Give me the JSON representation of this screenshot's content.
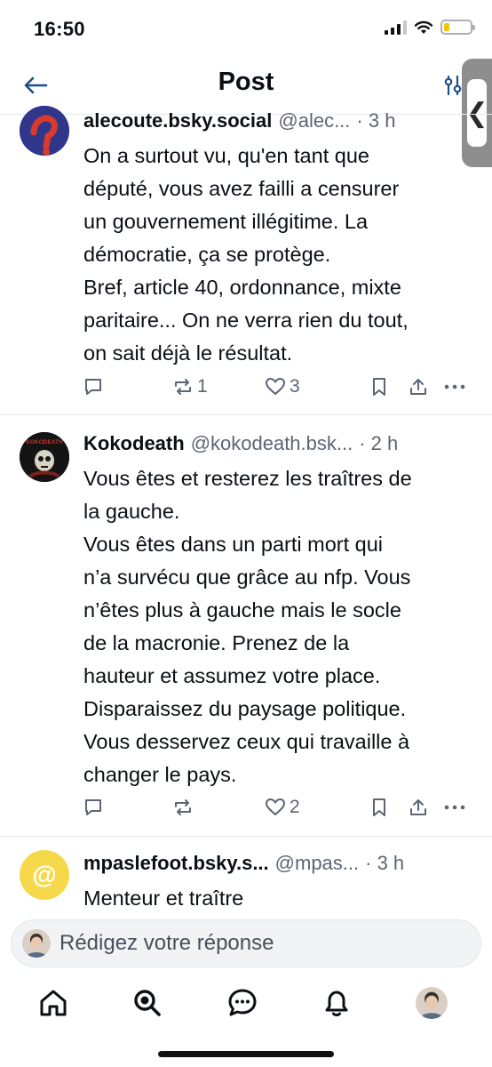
{
  "status_bar": {
    "time": "16:50"
  },
  "header": {
    "title": "Post"
  },
  "posts": [
    {
      "name": "alecoute.bsky.social",
      "handle": "@alec...",
      "time": "· 3 h",
      "lines": [
        "On a surtout vu, qu'en tant que",
        "député, vous avez failli a censurer",
        "un gouvernement illégitime. La",
        "démocratie, ça se protège.",
        "Bref, article 40, ordonnance, mixte",
        "paritaire... On ne verra rien du tout,",
        "on sait déjà le résultat."
      ],
      "reposts": "1",
      "likes": "3"
    },
    {
      "name": "Kokodeath",
      "handle": "@kokodeath.bsk...",
      "time": "· 2 h",
      "avatar_text": "KOKODEATH",
      "lines": [
        "Vous êtes et resterez les traîtres de",
        "la gauche.",
        "Vous êtes dans un parti mort qui",
        "n’a survécu que grâce au nfp. Vous",
        "n’êtes plus à gauche mais le socle",
        "de la macronie. Prenez de la",
        "hauteur et assumez votre place.",
        "Disparaissez du paysage politique.",
        "Vous desservez ceux qui travaille à",
        "changer le pays."
      ],
      "reposts": "",
      "likes": "2"
    },
    {
      "name": "mpaslefoot.bsky.s...",
      "handle": "@mpas...",
      "time": "· 3 h",
      "avatar_text": "@",
      "lines": [
        "Menteur et traître"
      ]
    }
  ],
  "composer": {
    "placeholder": "Rédigez votre réponse"
  },
  "colors": {
    "muted": "#5b6573",
    "accent_blue": "#1d4f8f",
    "avatar_yellow": "#f6d94a"
  }
}
